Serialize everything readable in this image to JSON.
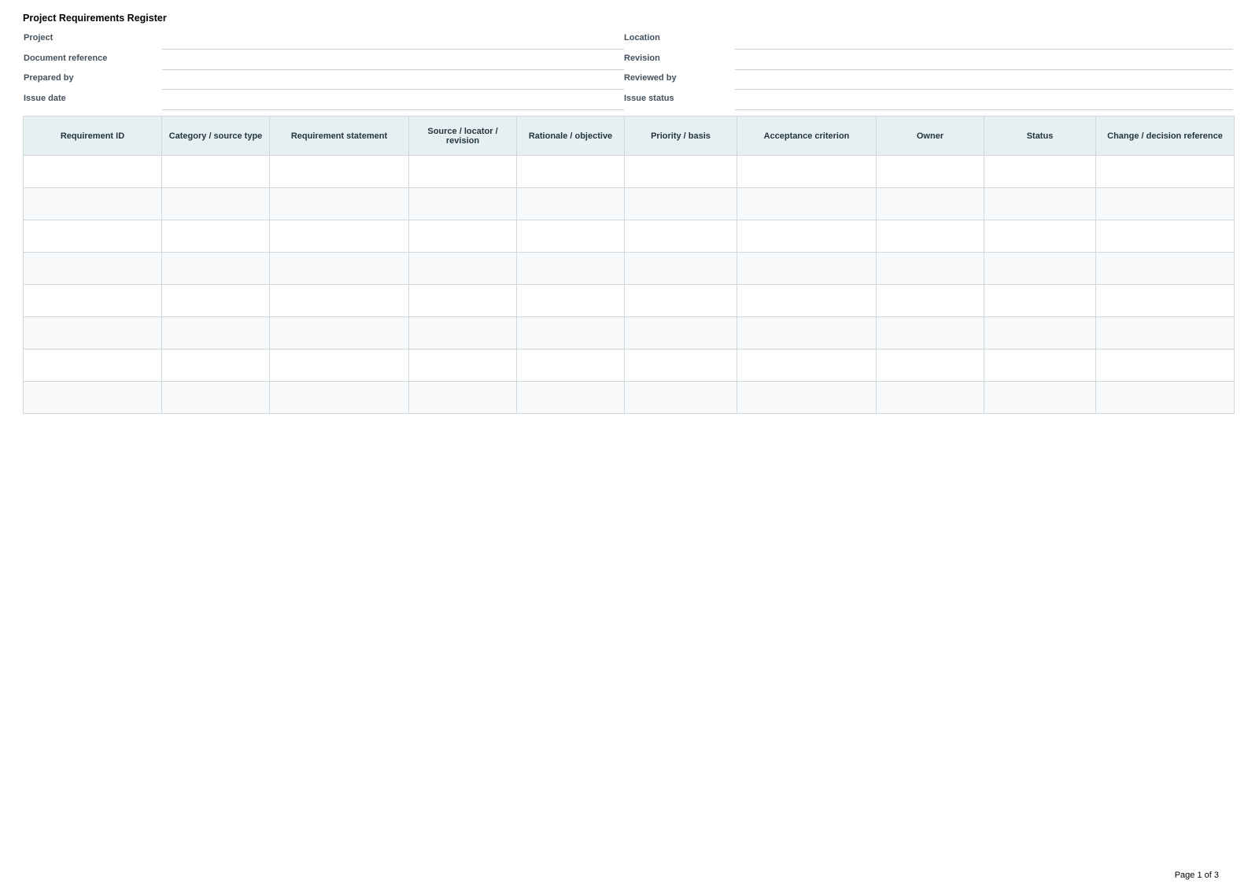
{
  "document": {
    "title": "Project Requirements Register",
    "page_label": "Page 1 of 3"
  },
  "meta_fields": [
    {
      "left_label": "Project",
      "left_value": "",
      "right_label": "Location",
      "right_value": ""
    },
    {
      "left_label": "Document reference",
      "left_value": "",
      "right_label": "Revision",
      "right_value": ""
    },
    {
      "left_label": "Prepared by",
      "left_value": "",
      "right_label": "Reviewed by",
      "right_value": ""
    },
    {
      "left_label": "Issue date",
      "left_value": "",
      "right_label": "Issue status",
      "right_value": ""
    }
  ],
  "table": {
    "columns": [
      "Requirement ID",
      "Category / source type",
      "Requirement statement",
      "Source / locator / revision",
      "Rationale / objective",
      "Priority / basis",
      "Acceptance criterion",
      "Owner",
      "Status",
      "Change / decision reference"
    ],
    "rows": [
      [
        "",
        "",
        "",
        "",
        "",
        "",
        "",
        "",
        "",
        ""
      ],
      [
        "",
        "",
        "",
        "",
        "",
        "",
        "",
        "",
        "",
        ""
      ],
      [
        "",
        "",
        "",
        "",
        "",
        "",
        "",
        "",
        "",
        ""
      ],
      [
        "",
        "",
        "",
        "",
        "",
        "",
        "",
        "",
        "",
        ""
      ],
      [
        "",
        "",
        "",
        "",
        "",
        "",
        "",
        "",
        "",
        ""
      ],
      [
        "",
        "",
        "",
        "",
        "",
        "",
        "",
        "",
        "",
        ""
      ],
      [
        "",
        "",
        "",
        "",
        "",
        "",
        "",
        "",
        "",
        ""
      ],
      [
        "",
        "",
        "",
        "",
        "",
        "",
        "",
        "",
        "",
        ""
      ]
    ]
  }
}
